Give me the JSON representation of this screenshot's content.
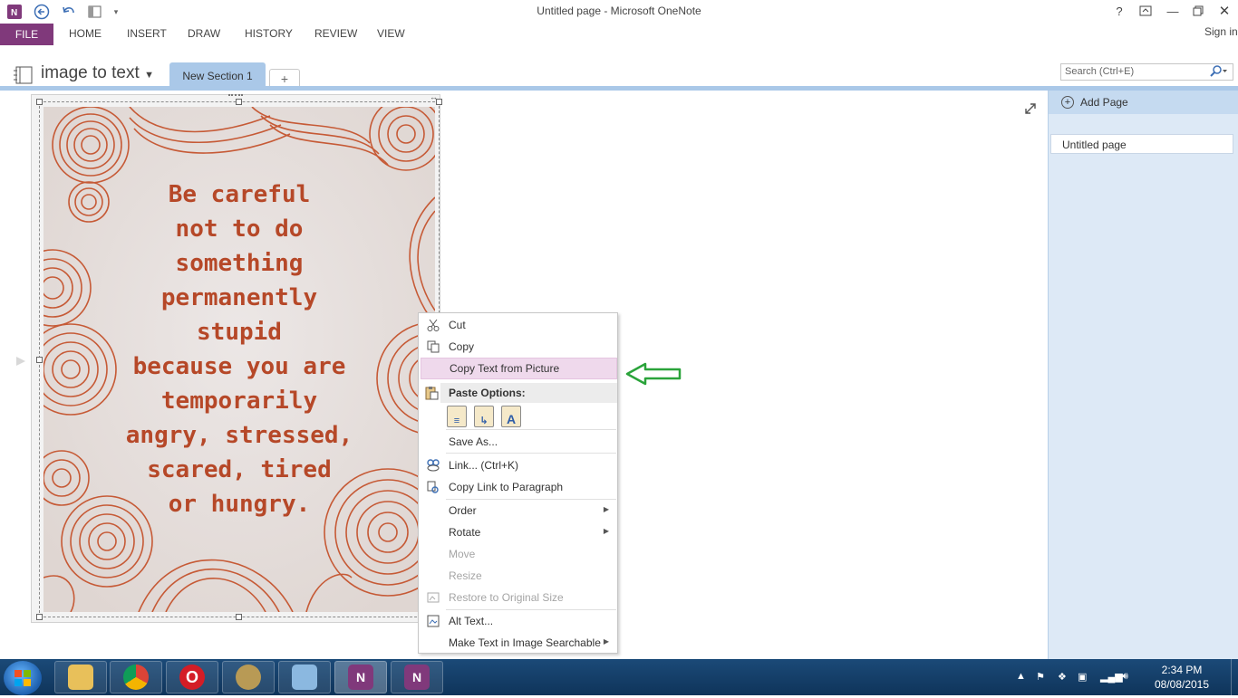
{
  "window": {
    "title": "Untitled page - Microsoft OneNote",
    "help": "?",
    "sign_in": "Sign in"
  },
  "ribbon": {
    "file": "FILE",
    "tabs": [
      "HOME",
      "INSERT",
      "DRAW",
      "HISTORY",
      "REVIEW",
      "VIEW"
    ]
  },
  "notebook": {
    "name": "image to text",
    "section": "New Section 1",
    "add_section": "+"
  },
  "search": {
    "placeholder": "Search (Ctrl+E)"
  },
  "pages": {
    "add_page": "Add Page",
    "items": [
      "Untitled page"
    ]
  },
  "quote": {
    "lines": [
      "Be careful",
      "not to do",
      "something",
      "permanently",
      "stupid",
      "because you are",
      "temporarily",
      "angry, stressed,",
      "scared, tired",
      "or hungry."
    ]
  },
  "context_menu": {
    "cut": "Cut",
    "copy": "Copy",
    "copy_text": "Copy Text from Picture",
    "paste_options": "Paste Options:",
    "save_as": "Save As...",
    "link": "Link...  (Ctrl+K)",
    "copy_link": "Copy Link to Paragraph",
    "order": "Order",
    "rotate": "Rotate",
    "move": "Move",
    "resize": "Resize",
    "restore": "Restore to Original Size",
    "alt_text": "Alt Text...",
    "make_searchable": "Make Text in Image Searchable"
  },
  "taskbar": {
    "time": "2:34 PM",
    "date": "08/08/2015"
  },
  "colors": {
    "file_tab": "#80397b",
    "section_tab": "#aac8e8",
    "highlight": "#efd9ec",
    "arrow": "#2aa33a",
    "quote_text": "#b64828"
  }
}
